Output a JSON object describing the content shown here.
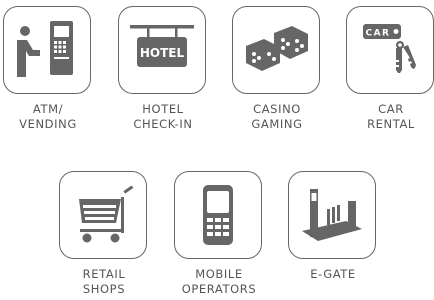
{
  "tiles": [
    {
      "id": "atm",
      "line1": "ATM/",
      "line2": "VENDING",
      "icon": "atm-icon"
    },
    {
      "id": "hotel",
      "line1": "HOTEL",
      "line2": "CHECK-IN",
      "icon": "hotel-sign-icon",
      "sign_text": "HOTEL"
    },
    {
      "id": "casino",
      "line1": "CASINO",
      "line2": "GAMING",
      "icon": "dice-icon"
    },
    {
      "id": "car",
      "line1": "CAR",
      "line2": "RENTAL",
      "icon": "car-keys-icon",
      "tag_text": "CAR"
    },
    {
      "id": "retail",
      "line1": "RETAIL",
      "line2": "SHOPS",
      "icon": "shopping-cart-icon"
    },
    {
      "id": "mobile",
      "line1": "MOBILE",
      "line2": "OPERATORS",
      "icon": "mobile-phone-icon"
    },
    {
      "id": "egate",
      "line1": "E-GATE",
      "line2": "",
      "icon": "e-gate-icon"
    }
  ],
  "colors": {
    "icon": "#666666",
    "border": "#666666",
    "text": "#555555"
  }
}
